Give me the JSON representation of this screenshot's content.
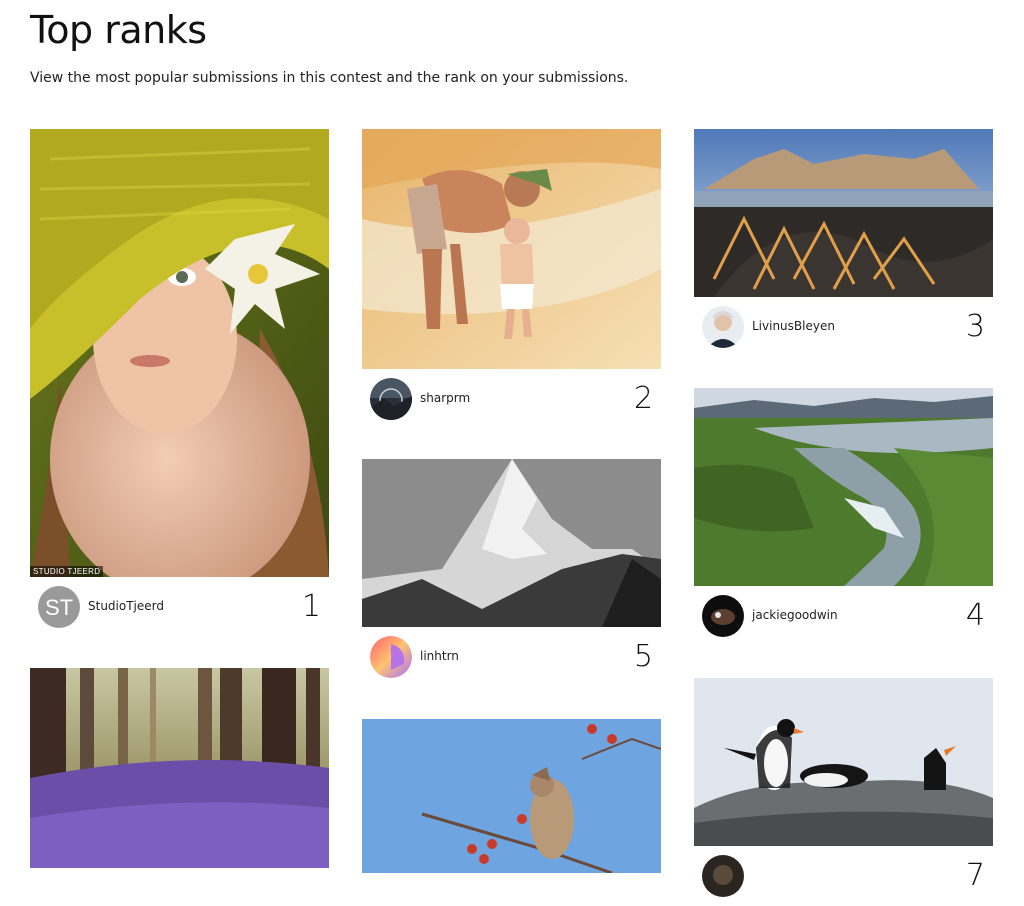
{
  "page": {
    "title": "Top ranks",
    "subtitle": "View the most popular submissions in this contest and the rank on your submissions."
  },
  "submissions": [
    {
      "rank": "1",
      "username": "StudioTjeerd",
      "avatar_initials": "ST",
      "watermark": "STUDIO TJEERD",
      "photo": "portrait-woman-yellow-hat"
    },
    {
      "rank": "2",
      "username": "sharprm",
      "photo": "father-and-child-on-beach"
    },
    {
      "rank": "3",
      "username": "LivinusBleyen",
      "photo": "mountain-dunes-landscape"
    },
    {
      "rank": "4",
      "username": "jackiegoodwin",
      "photo": "river-valley-waterfall"
    },
    {
      "rank": "5",
      "username": "linhtrn",
      "photo": "snowy-mountain-peak-bw"
    },
    {
      "rank": "",
      "username": "",
      "photo": "bluebell-forest"
    },
    {
      "rank": "",
      "username": "",
      "photo": "waxwing-bird-berries"
    },
    {
      "rank": "7",
      "username": "",
      "photo": "penguins-on-rock"
    }
  ]
}
